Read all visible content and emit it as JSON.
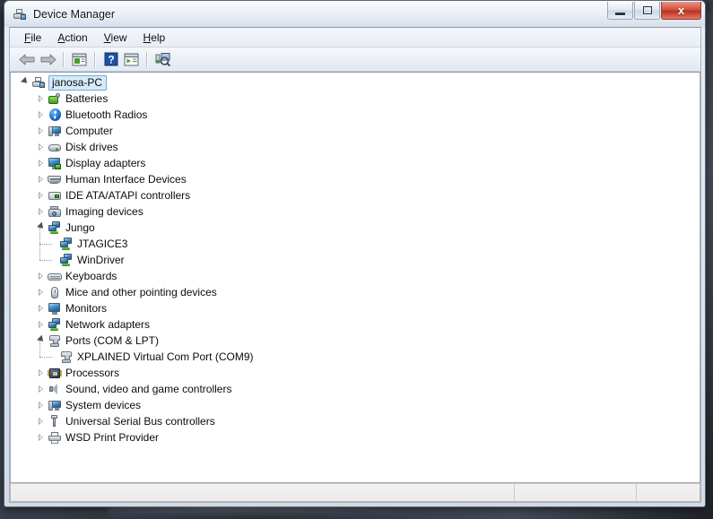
{
  "window": {
    "title": "Device Manager",
    "title_icon": "device-manager-icon",
    "caption": {
      "minimize": "–",
      "maximize": "□",
      "close": "x"
    }
  },
  "menubar": {
    "items": [
      {
        "label": "File",
        "mnemonic": "F"
      },
      {
        "label": "Action",
        "mnemonic": "A"
      },
      {
        "label": "View",
        "mnemonic": "V"
      },
      {
        "label": "Help",
        "mnemonic": "H"
      }
    ]
  },
  "toolbar": {
    "buttons": [
      {
        "name": "back-icon",
        "glyph": "⬅"
      },
      {
        "name": "forward-icon",
        "glyph": "➡"
      },
      {
        "name": "show-hide-tree-icon",
        "glyph": "▤"
      },
      {
        "name": "help-icon",
        "glyph": "?"
      },
      {
        "name": "properties-icon",
        "glyph": "▤"
      },
      {
        "name": "scan-hardware-changes-icon",
        "glyph": "⌕"
      }
    ]
  },
  "tree": {
    "root": {
      "label": "janosa-PC",
      "icon": "computer-icon",
      "expanded": true,
      "selected": true
    },
    "nodes": [
      {
        "label": "Batteries",
        "icon": "battery-icon",
        "expanded": false,
        "level": 1
      },
      {
        "label": "Bluetooth Radios",
        "icon": "bluetooth-icon",
        "expanded": false,
        "level": 1
      },
      {
        "label": "Computer",
        "icon": "computer-device-icon",
        "expanded": false,
        "level": 1
      },
      {
        "label": "Disk drives",
        "icon": "disk-drive-icon",
        "expanded": false,
        "level": 1
      },
      {
        "label": "Display adapters",
        "icon": "display-adapter-icon",
        "expanded": false,
        "level": 1
      },
      {
        "label": "Human Interface Devices",
        "icon": "hid-icon",
        "expanded": false,
        "level": 1
      },
      {
        "label": "IDE ATA/ATAPI controllers",
        "icon": "ide-controller-icon",
        "expanded": false,
        "level": 1
      },
      {
        "label": "Imaging devices",
        "icon": "imaging-device-icon",
        "expanded": false,
        "level": 1
      },
      {
        "label": "Jungo",
        "icon": "jungo-icon",
        "expanded": true,
        "level": 1
      },
      {
        "label": "JTAGICE3",
        "icon": "jungo-device-icon",
        "expanded": null,
        "level": 2
      },
      {
        "label": "WinDriver",
        "icon": "jungo-device-icon",
        "expanded": null,
        "level": 2
      },
      {
        "label": "Keyboards",
        "icon": "keyboard-icon",
        "expanded": false,
        "level": 1
      },
      {
        "label": "Mice and other pointing devices",
        "icon": "mouse-icon",
        "expanded": false,
        "level": 1
      },
      {
        "label": "Monitors",
        "icon": "monitor-icon",
        "expanded": false,
        "level": 1
      },
      {
        "label": "Network adapters",
        "icon": "network-adapter-icon",
        "expanded": false,
        "level": 1
      },
      {
        "label": "Ports (COM & LPT)",
        "icon": "port-icon",
        "expanded": true,
        "level": 1
      },
      {
        "label": "XPLAINED Virtual Com Port (COM9)",
        "icon": "port-icon",
        "expanded": null,
        "level": 2
      },
      {
        "label": "Processors",
        "icon": "processor-icon",
        "expanded": false,
        "level": 1
      },
      {
        "label": "Sound, video and game controllers",
        "icon": "sound-icon",
        "expanded": false,
        "level": 1
      },
      {
        "label": "System devices",
        "icon": "system-device-icon",
        "expanded": false,
        "level": 1
      },
      {
        "label": "Universal Serial Bus controllers",
        "icon": "usb-icon",
        "expanded": false,
        "level": 1
      },
      {
        "label": "WSD Print Provider",
        "icon": "printer-icon",
        "expanded": false,
        "level": 1
      }
    ]
  },
  "statusbar": {
    "pane_main": "",
    "pane_2": "",
    "pane_3": ""
  },
  "colors": {
    "selection_fill": "#d7eaf9",
    "selection_border": "#6fa9da",
    "close_button": "#b8321f",
    "tree_background": "#ffffff",
    "text": "#0a0c0f"
  }
}
